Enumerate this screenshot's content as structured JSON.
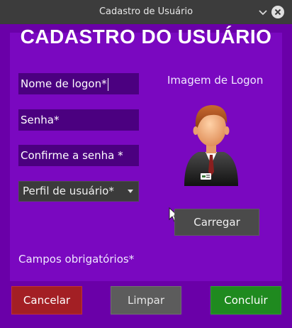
{
  "window": {
    "title": "Cadastro de Usuário"
  },
  "form": {
    "heading": "CADASTRO DO USUÁRIO",
    "login_name_placeholder": "Nome de logon*",
    "password_placeholder": "Senha*",
    "confirm_password_placeholder": "Confirme a senha *",
    "profile_select": {
      "selected": "Perfil de usuário*"
    },
    "required_note": "Campos obrigatórios*"
  },
  "logon_image": {
    "label": "Imagem de Logon",
    "icon": "user-avatar-icon",
    "load_label": "Carregar"
  },
  "actions": {
    "cancel_label": "Cancelar",
    "clear_label": "Limpar",
    "done_label": "Concluir"
  },
  "colors": {
    "background": "#6a00a8",
    "cancel": "#a31f24",
    "clear": "#5c5c5c",
    "done": "#1f8a1f"
  }
}
